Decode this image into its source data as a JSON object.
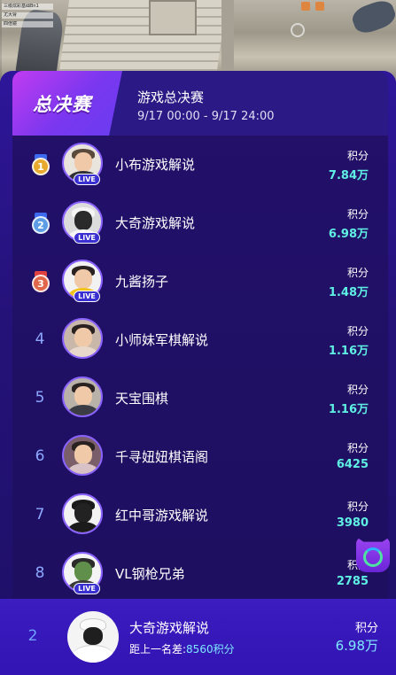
{
  "game_hud": {
    "lines": [
      "三级炫彩基础Bn1",
      "尤大肾",
      "四倍镜"
    ]
  },
  "header": {
    "badge": "总决赛",
    "title": "游戏总决赛",
    "time": "9/17 00:00 - 9/17 24:00"
  },
  "ranking": [
    {
      "rank": "1",
      "name": "小布游戏解说",
      "score_label": "积分",
      "score": "7.84万",
      "live": "LIVE",
      "medal_color": "#e8a92c",
      "ribbon_color": "#3e6af0"
    },
    {
      "rank": "2",
      "name": "大奇游戏解说",
      "score_label": "积分",
      "score": "6.98万",
      "live": "LIVE",
      "medal_color": "#5c9de6",
      "ribbon_color": "#3e6af0"
    },
    {
      "rank": "3",
      "name": "九酱扬子",
      "score_label": "积分",
      "score": "1.48万",
      "live": "LIVE",
      "medal_color": "#e2674a",
      "ribbon_color": "#e04040"
    },
    {
      "rank": "4",
      "name": "小师妹军棋解说",
      "score_label": "积分",
      "score": "1.16万"
    },
    {
      "rank": "5",
      "name": "天宝围棋",
      "score_label": "积分",
      "score": "1.16万"
    },
    {
      "rank": "6",
      "name": "千寻妞妞棋语阁",
      "score_label": "积分",
      "score": "6425"
    },
    {
      "rank": "7",
      "name": "红中哥游戏解说",
      "score_label": "积分",
      "score": "3980"
    },
    {
      "rank": "8",
      "name": "VL钢枪兄弟",
      "score_label": "积分",
      "score": "2785",
      "live": "LIVE"
    }
  ],
  "mine": {
    "rank": "2",
    "name": "大奇游戏解说",
    "gap_prefix": "距上一名差:",
    "gap_value": "8560积分",
    "score_label": "积分",
    "score": "6.98万"
  },
  "colors": {
    "accent": "#5ff0e4",
    "panel": "#251279",
    "badge": "#a23cf0"
  }
}
